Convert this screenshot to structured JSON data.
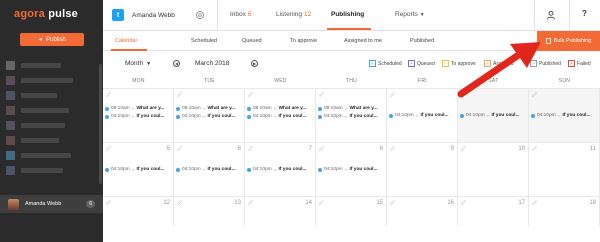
{
  "app": {
    "logo_part1": "agora",
    "logo_part2": "pulse"
  },
  "sidebar": {
    "publish_label": "Publish",
    "active_account": {
      "name": "Amanda Webb",
      "count": "6"
    }
  },
  "topnav": {
    "account_name": "Amanda Webb",
    "tabs": [
      {
        "label": "Inbox",
        "count": "6"
      },
      {
        "label": "Listening",
        "count": "12"
      },
      {
        "label": "Publishing",
        "count": ""
      },
      {
        "label": "Reports",
        "count": ""
      }
    ],
    "help_label": "?"
  },
  "subtabs": [
    "Calendar",
    "Scheduled",
    "Queued",
    "To approve",
    "Assigned to me",
    "Published"
  ],
  "bulk_publishing_label": "Bulk Publishing",
  "toolbar": {
    "view_label": "Month",
    "date_label": "March 2018",
    "legend": [
      "Scheduled",
      "Queued",
      "To approve",
      "Assigned",
      "Published",
      "Failed"
    ]
  },
  "calendar": {
    "days_of_week": [
      "MON",
      "TUE",
      "WED",
      "THU",
      "FRI",
      "SAT",
      "SUN"
    ],
    "weeks": [
      [
        {
          "day": "",
          "events": [
            {
              "time": "09:10am",
              "title": "What are y..."
            },
            {
              "time": "04:10pm",
              "title": "If you coul..."
            }
          ]
        },
        {
          "day": "",
          "events": [
            {
              "time": "09:10am",
              "title": "What are y..."
            },
            {
              "time": "04:10pm",
              "title": "If you coul..."
            }
          ]
        },
        {
          "day": "",
          "events": [
            {
              "time": "09:10am",
              "title": "What are y..."
            },
            {
              "time": "04:10pm",
              "title": "If you coul..."
            }
          ]
        },
        {
          "day": "",
          "events": [
            {
              "time": "09:10am",
              "title": "What are y..."
            },
            {
              "time": "04:10pm",
              "title": "If you coul..."
            }
          ]
        },
        {
          "day": "",
          "events": [
            {
              "time": "04:10pm",
              "title": "If you coul..."
            }
          ]
        },
        {
          "day": "",
          "events": [
            {
              "time": "04:10pm",
              "title": "If you coul..."
            }
          ]
        },
        {
          "day": "",
          "events": [
            {
              "time": "04:10pm",
              "title": "If you coul..."
            }
          ]
        }
      ],
      [
        {
          "day": "5",
          "events": [
            {
              "time": "04:10pm",
              "title": "If you coul..."
            }
          ]
        },
        {
          "day": "6",
          "events": [
            {
              "time": "04:10pm",
              "title": "If you coul..."
            }
          ]
        },
        {
          "day": "7",
          "events": [
            {
              "time": "04:10pm",
              "title": "If you coul..."
            }
          ]
        },
        {
          "day": "8",
          "events": [
            {
              "time": "04:10pm",
              "title": "If you coul..."
            }
          ]
        },
        {
          "day": "9",
          "events": []
        },
        {
          "day": "10",
          "events": []
        },
        {
          "day": "11",
          "events": []
        }
      ],
      [
        {
          "day": "12",
          "events": []
        },
        {
          "day": "13",
          "events": []
        },
        {
          "day": "14",
          "events": []
        },
        {
          "day": "15",
          "events": []
        },
        {
          "day": "16",
          "events": []
        },
        {
          "day": "17",
          "events": []
        },
        {
          "day": "18",
          "events": []
        }
      ]
    ]
  },
  "colors": {
    "accent": "#f26a35",
    "sidebar_bg": "#2b2b2b",
    "scheduled": "#4aa3df",
    "queued": "#7b6cc8",
    "to_approve": "#e8c93a",
    "assigned": "#f5a25d",
    "published": "#9e9e9e",
    "failed": "#e04b3c"
  }
}
